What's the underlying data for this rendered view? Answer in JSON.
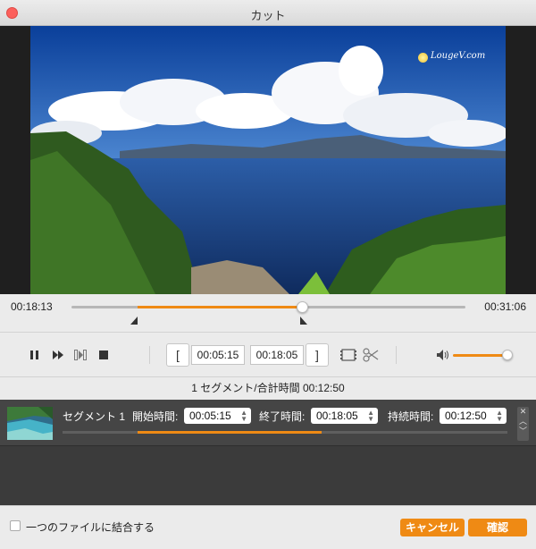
{
  "window": {
    "title": "カット"
  },
  "video": {
    "watermark": "LougeV.com"
  },
  "timeline": {
    "current_time": "00:18:13",
    "total_time": "00:31:06"
  },
  "controls": {
    "start_time": "00:05:15",
    "end_time": "00:18:05",
    "start_bracket": "[",
    "end_bracket": "]",
    "volume_level": 1.0
  },
  "summary": {
    "text": "1 セグメント/合計時間 00:12:50"
  },
  "segments": [
    {
      "name": "セグメント 1",
      "start_label": "開始時間:",
      "start_value": "00:05:15",
      "end_label": "終了時間:",
      "end_value": "00:18:05",
      "duration_label": "持続時間:",
      "duration_value": "00:12:50"
    }
  ],
  "footer": {
    "merge_label": "一つのファイルに結合する",
    "merge_checked": false,
    "cancel_label": "キャンセル",
    "ok_label": "確認"
  },
  "colors": {
    "accent": "#ef8a14",
    "close": "#fc605c",
    "segment_bg": "#454545"
  },
  "icons": [
    "close-icon",
    "pause-icon",
    "fast-forward-icon",
    "next-frame-icon",
    "stop-icon",
    "film-icon",
    "scissors-icon",
    "volume-icon",
    "sun-icon"
  ]
}
